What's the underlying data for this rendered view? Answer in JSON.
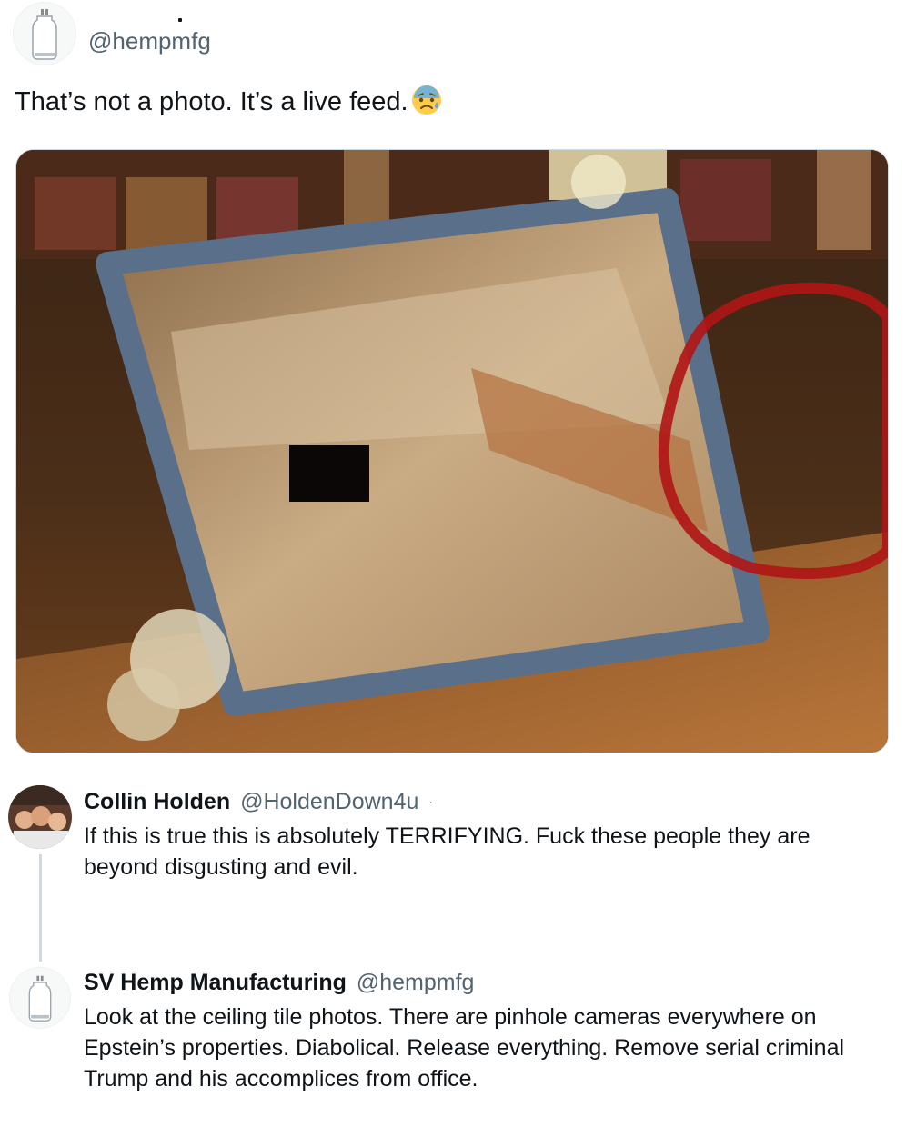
{
  "tweet": {
    "author_handle": "@hempmfg",
    "text": "That’s not a photo. It’s a live feed.",
    "emoji_name": "anxious-face-with-sweat-icon"
  },
  "media": {
    "description_icon": "photo-of-mirror-frame-with-red-circle",
    "circle_color": "#b01515"
  },
  "replies": [
    {
      "name": "Collin Holden",
      "handle": "@HoldenDown4u",
      "separator": "·",
      "text": "If this is true this is absolutely TERRIFYING. Fuck these people they are beyond disgusting and evil."
    },
    {
      "name": "SV Hemp Manufacturing",
      "handle": "@hempmfg",
      "text": "Look at the ceiling tile photos. There are pinhole cameras everywhere on Epstein’s properties. Diabolical. Release everything. Remove serial criminal Trump and his accomplices from office."
    }
  ],
  "colors": {
    "text_primary": "#0f1419",
    "text_secondary": "#536471",
    "thread_line": "#cfd9de"
  }
}
